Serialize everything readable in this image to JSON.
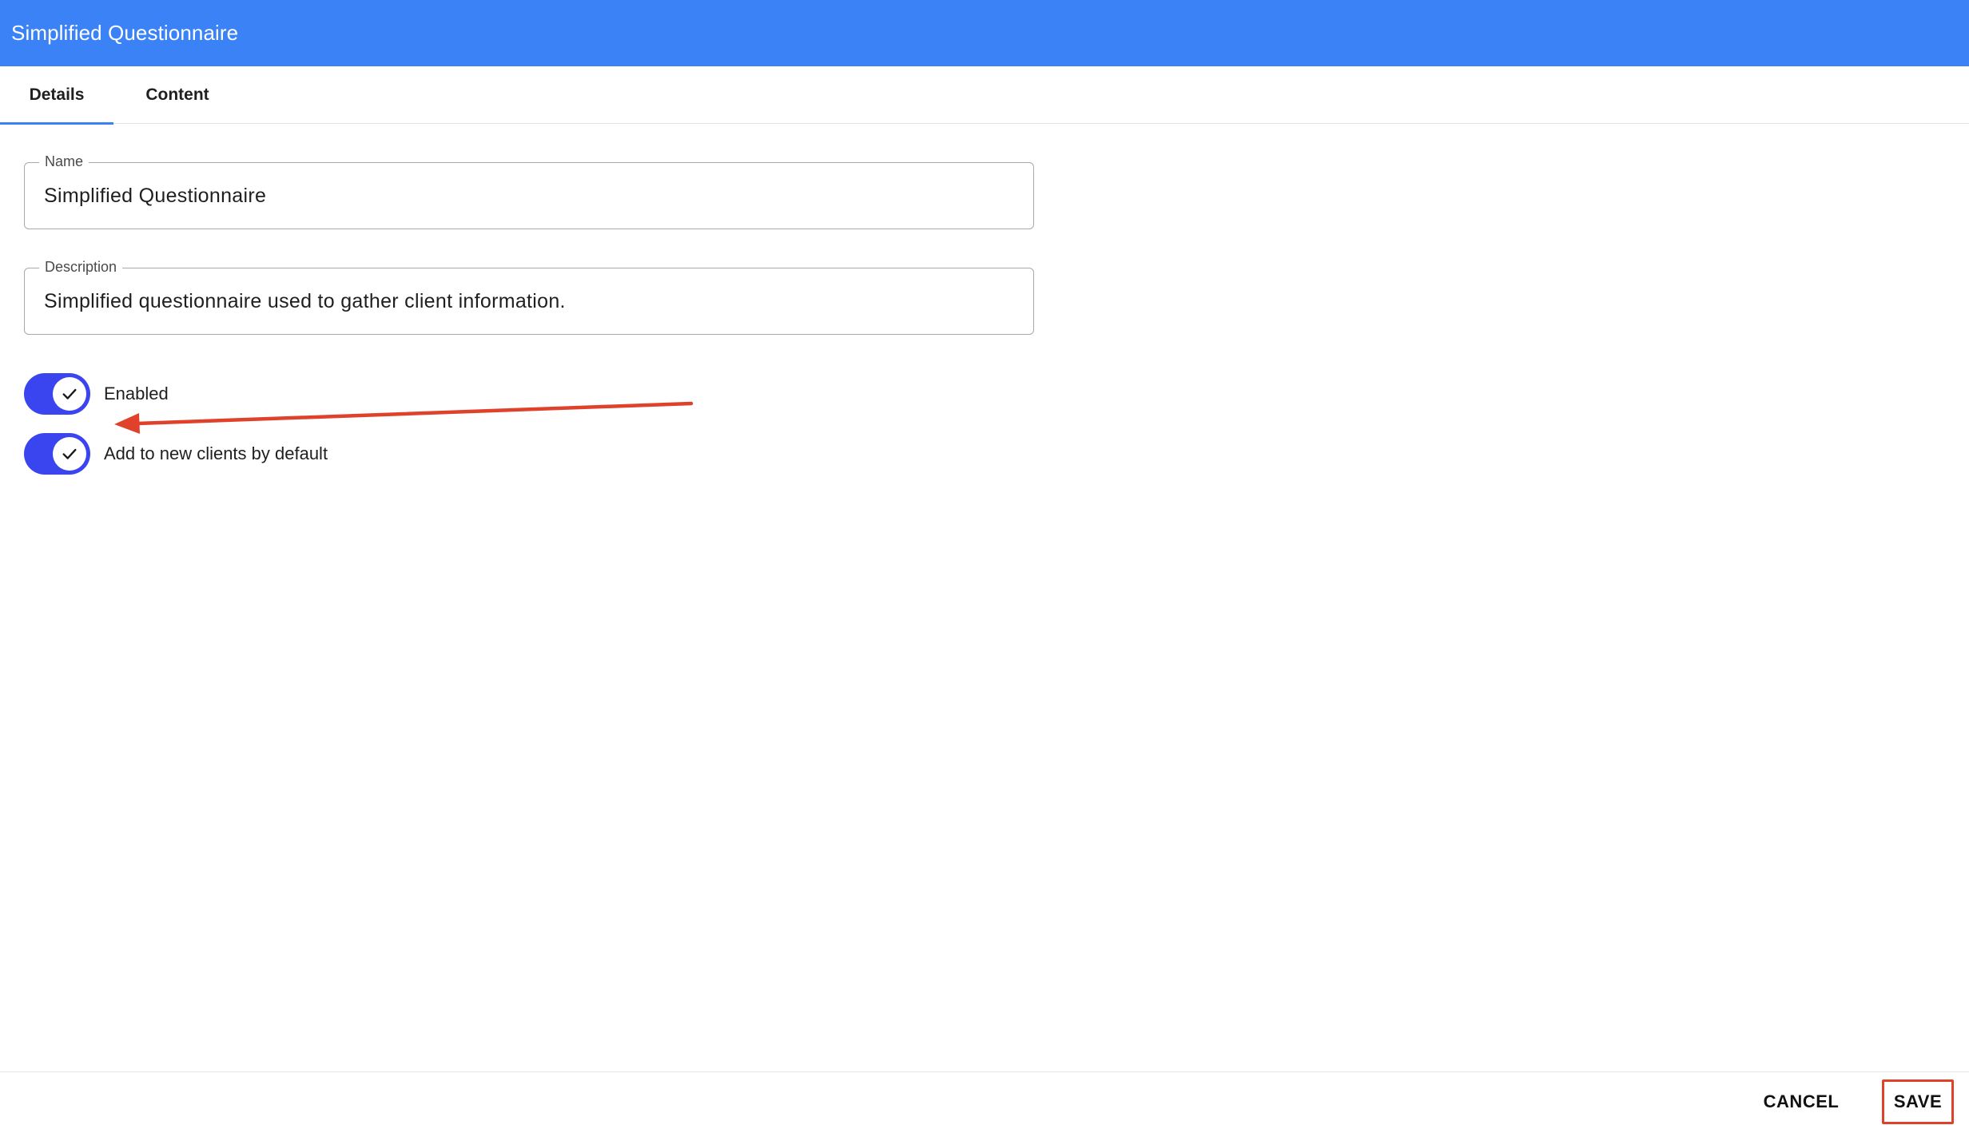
{
  "header": {
    "title": "Simplified Questionnaire"
  },
  "tabs": [
    {
      "label": "Details",
      "active": true
    },
    {
      "label": "Content",
      "active": false
    }
  ],
  "form": {
    "name": {
      "label": "Name",
      "value": "Simplified Questionnaire"
    },
    "description": {
      "label": "Description",
      "value": "Simplified questionnaire used to gather client information."
    },
    "switches": [
      {
        "label": "Enabled",
        "checked": true
      },
      {
        "label": "Add to new clients by default",
        "checked": true
      }
    ]
  },
  "footer": {
    "cancel_label": "CANCEL",
    "save_label": "SAVE"
  },
  "colors": {
    "header": "#3b82f6",
    "switch_on": "#3a45f0",
    "annotation": "#e0412a"
  },
  "icons": {
    "switch_thumb": "check-icon",
    "annotation": "arrow-annotation"
  }
}
